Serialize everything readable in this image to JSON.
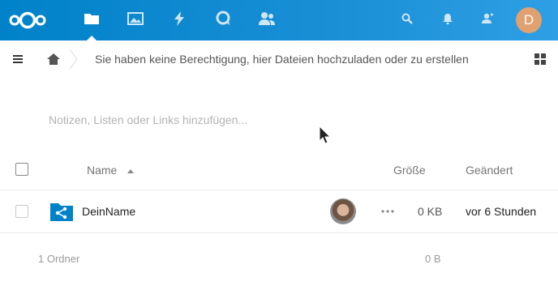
{
  "header": {
    "logo_icon": "nextcloud-logo-icon",
    "apps": [
      {
        "name": "Dateien",
        "icon": "folder-icon",
        "active": true
      },
      {
        "name": "Fotos",
        "icon": "image-icon",
        "active": false
      },
      {
        "name": "Aktivität",
        "icon": "lightning-icon",
        "active": false
      },
      {
        "name": "Talk",
        "icon": "talk-icon",
        "active": false
      },
      {
        "name": "Kontakte",
        "icon": "contacts-icon",
        "active": false
      }
    ],
    "right_icons": [
      "search-icon",
      "bell-icon",
      "contacts-menu-icon"
    ],
    "user_avatar_initial": "D",
    "user_avatar_color": "#e0a070",
    "brand_color": "#0082c9"
  },
  "breadcrumb": {
    "home_icon": "home-icon",
    "no_permission_message": "Sie haben keine Berechtigung, hier Dateien hochzuladen oder zu erstellen"
  },
  "notes": {
    "placeholder": "Notizen, Listen oder Links hinzufügen..."
  },
  "table": {
    "headers": {
      "name": "Name",
      "size": "Größe",
      "modified": "Geändert"
    },
    "sort": {
      "column": "name",
      "direction": "ascending"
    },
    "rows": [
      {
        "name": "DeinName",
        "type": "shared-folder",
        "size": "0 KB",
        "modified": "vor 6 Stunden"
      }
    ],
    "summary": {
      "folders": "1 Ordner",
      "total_size": "0 B"
    }
  }
}
